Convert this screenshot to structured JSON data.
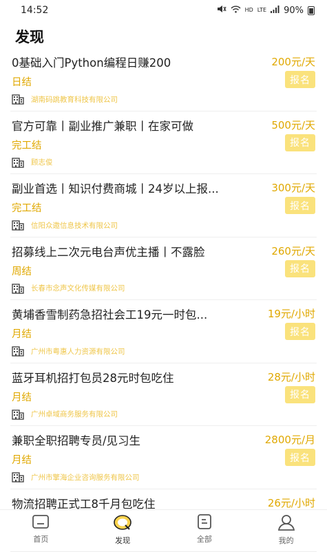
{
  "status_bar": {
    "time": "14:52",
    "hd": "HD",
    "lte": "LTE",
    "battery": "90%"
  },
  "page": {
    "title": "发现"
  },
  "jobs": [
    {
      "title": "0基础入门Python编程日赚200",
      "salary": "200元/天",
      "settlement": "日结",
      "apply": "报名",
      "company": "湖南码跳教育科技有限公司"
    },
    {
      "title": "官方可靠丨副业推广兼职丨在家可做",
      "salary": "500元/天",
      "settlement": "完工结",
      "apply": "报名",
      "company": "顾志俊"
    },
    {
      "title": "副业首选丨知识付费商城丨24岁以上报...",
      "salary": "300元/天",
      "settlement": "完工结",
      "apply": "报名",
      "company": "信阳众邀信息技术有限公司"
    },
    {
      "title": "招募线上二次元电台声优主播丨不露脸",
      "salary": "260元/天",
      "settlement": "周结",
      "apply": "报名",
      "company": "长春市念声文化传媒有限公司"
    },
    {
      "title": "黄埔香雪制药急招社会工19元一时包...",
      "salary": "19元/小时",
      "settlement": "月结",
      "apply": "报名",
      "company": "广州市粤惠人力资源有限公司"
    },
    {
      "title": "蓝牙耳机招打包员28元时包吃住",
      "salary": "28元/小时",
      "settlement": "月结",
      "apply": "报名",
      "company": "广州卓域商务服务有限公司"
    },
    {
      "title": "兼职全职招聘专员/见习生",
      "salary": "2800元/月",
      "settlement": "月结",
      "apply": "报名",
      "company": "广州市擎海企业咨询服务有限公司"
    },
    {
      "title": "物流招聘正式工8千月包吃住",
      "salary": "26元/小时",
      "settlement": "",
      "apply": "",
      "company": ""
    }
  ],
  "tabbar": {
    "tabs": [
      {
        "label": "首页",
        "icon": "home-icon"
      },
      {
        "label": "发现",
        "icon": "discover-icon",
        "active": true
      },
      {
        "label": "全部",
        "icon": "document-icon"
      },
      {
        "label": "我的",
        "icon": "profile-icon"
      }
    ]
  },
  "colors": {
    "accent": "#e0a800",
    "button_bg": "#fae27c",
    "company_text": "#efc64a"
  }
}
